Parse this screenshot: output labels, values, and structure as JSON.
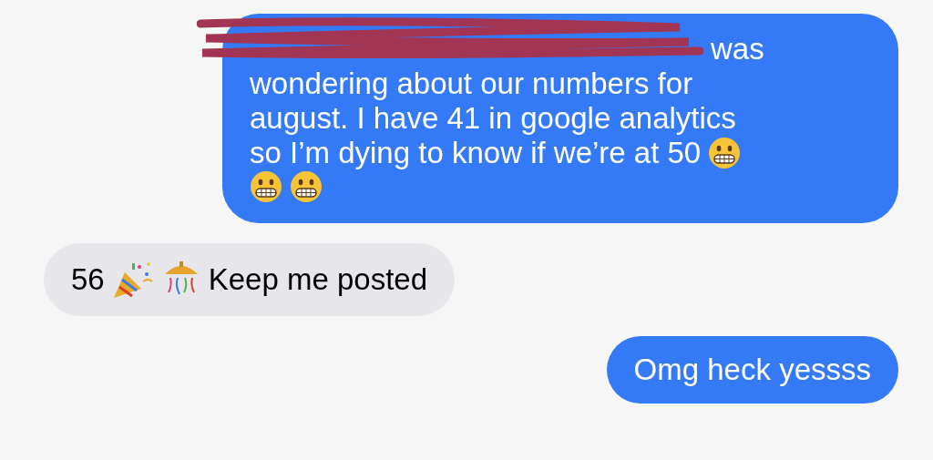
{
  "messages": [
    {
      "kind": "sent",
      "lines": [
        [
          {
            "kind": "redacted"
          },
          {
            "kind": "text",
            "text": "was"
          }
        ],
        [
          {
            "kind": "text",
            "text": "wondering about our numbers for"
          }
        ],
        [
          {
            "kind": "text",
            "text": "august. I have 41 in google analytics"
          }
        ],
        [
          {
            "kind": "text",
            "text": "so I’m dying to know if we’re at 50"
          },
          {
            "kind": "grimace"
          }
        ],
        [
          {
            "kind": "grimace"
          },
          {
            "kind": "grimace"
          }
        ]
      ]
    },
    {
      "kind": "received",
      "lines": [
        [
          {
            "kind": "text",
            "text": "56"
          },
          {
            "kind": "popper"
          },
          {
            "kind": "confetti"
          },
          {
            "kind": "text",
            "text": "Keep me posted"
          }
        ]
      ]
    },
    {
      "kind": "sent",
      "lines": [
        [
          {
            "kind": "text",
            "text": "Omg heck yessss"
          }
        ]
      ]
    }
  ]
}
